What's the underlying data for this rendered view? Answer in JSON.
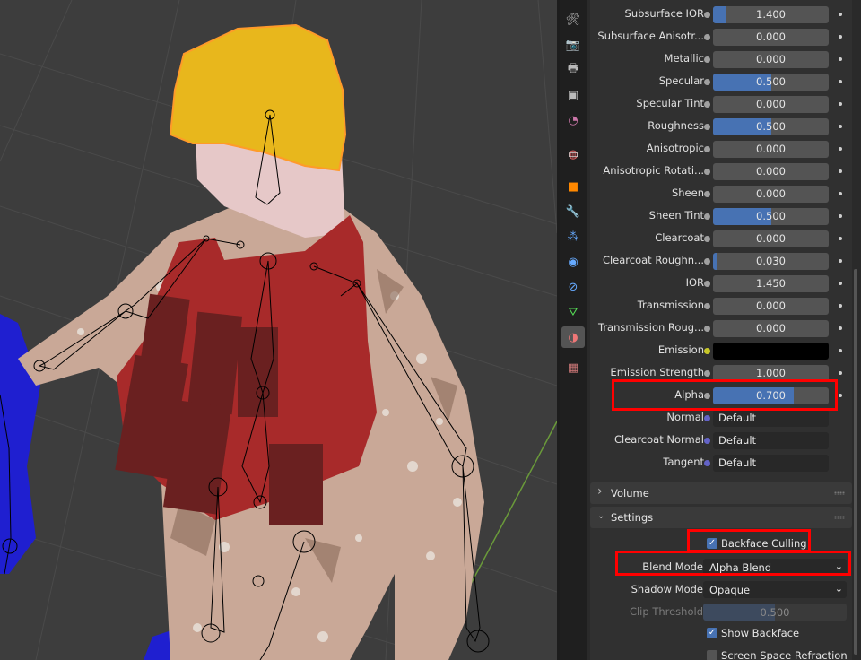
{
  "panel": {
    "properties": [
      {
        "label": "Subsurface IOR",
        "value": "1.400",
        "fill": 0.12
      },
      {
        "label": "Subsurface Anisotr...",
        "value": "0.000",
        "fill": 0
      },
      {
        "label": "Metallic",
        "value": "0.000",
        "fill": 0
      },
      {
        "label": "Specular",
        "value": "0.500",
        "fill": 0.5
      },
      {
        "label": "Specular Tint",
        "value": "0.000",
        "fill": 0
      },
      {
        "label": "Roughness",
        "value": "0.500",
        "fill": 0.5
      },
      {
        "label": "Anisotropic",
        "value": "0.000",
        "fill": 0
      },
      {
        "label": "Anisotropic Rotati...",
        "value": "0.000",
        "fill": 0
      },
      {
        "label": "Sheen",
        "value": "0.000",
        "fill": 0
      },
      {
        "label": "Sheen Tint",
        "value": "0.500",
        "fill": 0.5
      },
      {
        "label": "Clearcoat",
        "value": "0.000",
        "fill": 0
      },
      {
        "label": "Clearcoat Roughn...",
        "value": "0.030",
        "fill": 0.03
      },
      {
        "label": "IOR",
        "value": "1.450",
        "fill": 0
      },
      {
        "label": "Transmission",
        "value": "0.000",
        "fill": 0
      },
      {
        "label": "Transmission Roug...",
        "value": "0.000",
        "fill": 0
      },
      {
        "label": "Emission",
        "value": "",
        "kind": "color",
        "color": "#000000"
      },
      {
        "label": "Emission Strength",
        "value": "1.000",
        "fill": 0
      },
      {
        "label": "Alpha",
        "value": "0.700",
        "fill": 0.7
      },
      {
        "label": "Normal",
        "value": "Default",
        "kind": "vector"
      },
      {
        "label": "Clearcoat Normal",
        "value": "Default",
        "kind": "vector"
      },
      {
        "label": "Tangent",
        "value": "Default",
        "kind": "vector"
      }
    ],
    "volume_header": "Volume",
    "settings_header": "Settings",
    "settings": {
      "backface_culling_label": "Backface Culling",
      "blend_mode_label": "Blend Mode",
      "blend_mode_value": "Alpha Blend",
      "shadow_mode_label": "Shadow Mode",
      "shadow_mode_value": "Opaque",
      "clip_threshold_label": "Clip Threshold",
      "clip_threshold_value": "0.500",
      "show_backface_label": "Show Backface",
      "ssr_label": "Screen Space Refraction"
    }
  },
  "tabs": [
    "tool-icon",
    "render-icon",
    "output-icon",
    "view-layer-icon",
    "scene-icon",
    "world-icon",
    "collection-icon",
    "object-icon",
    "modifier-icon",
    "particles-icon",
    "physics-icon",
    "constraints-icon",
    "object-data-icon",
    "material-icon",
    "texture-icon"
  ],
  "colors": {
    "accent": "#4772b3",
    "highlight": "#ff0000"
  }
}
